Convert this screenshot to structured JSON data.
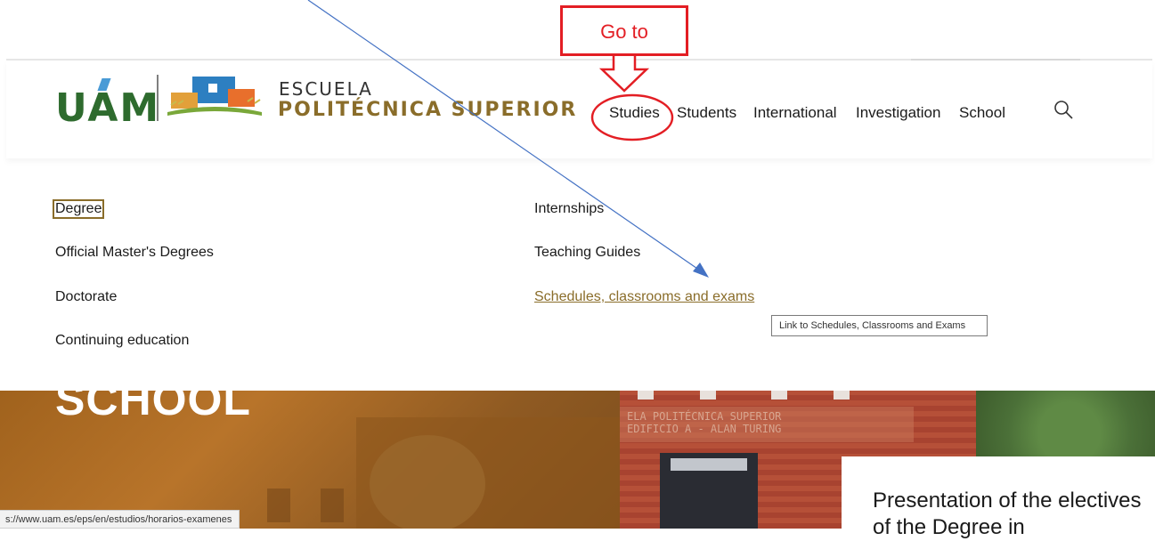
{
  "logo": {
    "uam": "UAM",
    "line1": "ESCUELA",
    "line2": "POLITÉCNICA SUPERIOR"
  },
  "nav": {
    "items": [
      {
        "label": "Studies"
      },
      {
        "label": "Students"
      },
      {
        "label": "International"
      },
      {
        "label": "Investigation"
      },
      {
        "label": "School"
      }
    ],
    "search_icon": "search-icon"
  },
  "menu": {
    "left": [
      {
        "label": "Degree"
      },
      {
        "label": "Official Master's Degrees"
      },
      {
        "label": "Doctorate"
      },
      {
        "label": "Continuing education"
      }
    ],
    "right": [
      {
        "label": "Internships"
      },
      {
        "label": "Teaching Guides"
      },
      {
        "label": "Schedules, classrooms and exams"
      }
    ]
  },
  "tooltip": "Link to Schedules, Classrooms and Exams",
  "hero": {
    "title": "SCHOOL",
    "sign_line1": "ELA  POLITÉCNICA  SUPERIOR",
    "sign_line2": "EDIFICIO A - ALAN TURING"
  },
  "card": {
    "title": "Presentation of the electives of the Degree in"
  },
  "status_url": "s://www.uam.es/eps/en/estudios/horarios-examenes",
  "annotation": {
    "callout": "Go to",
    "color": "#e31e24",
    "arrow_color": "#4472c4"
  },
  "colors": {
    "brand_green": "#2e6b2e",
    "brand_gold": "#8a6d2a"
  }
}
